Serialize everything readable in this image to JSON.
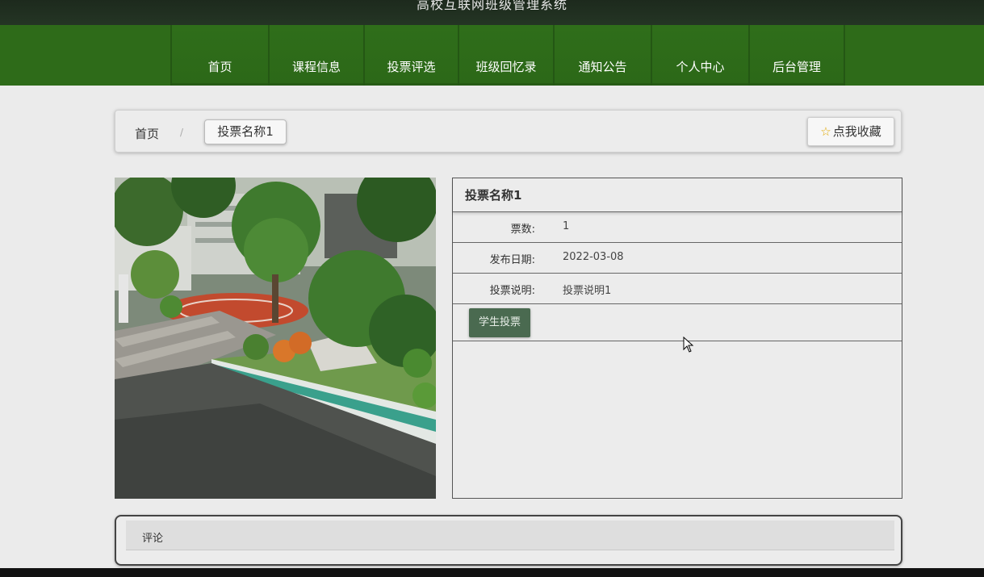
{
  "header": {
    "site_title": "高校互联网班级管理系统"
  },
  "nav": {
    "items": [
      {
        "label": "首页"
      },
      {
        "label": "课程信息"
      },
      {
        "label": "投票评选"
      },
      {
        "label": "班级回忆录"
      },
      {
        "label": "通知公告"
      },
      {
        "label": "个人中心"
      },
      {
        "label": "后台管理"
      }
    ]
  },
  "breadcrumb": {
    "home": "首页",
    "separator": "/",
    "current": "投票名称1"
  },
  "favorite": {
    "label": "点我收藏",
    "icon": "star-icon"
  },
  "detail": {
    "title": "投票名称1",
    "rows": [
      {
        "label": "票数:",
        "value": "1"
      },
      {
        "label": "发布日期:",
        "value": "2022-03-08"
      },
      {
        "label": "投票说明:",
        "value": "投票说明1"
      }
    ],
    "vote_button": "学生投票"
  },
  "comments": {
    "label": "评论"
  },
  "colors": {
    "nav_green": "#2e6b19",
    "vote_button": "#4a6a50",
    "top_bar": "#1d2a1d"
  }
}
